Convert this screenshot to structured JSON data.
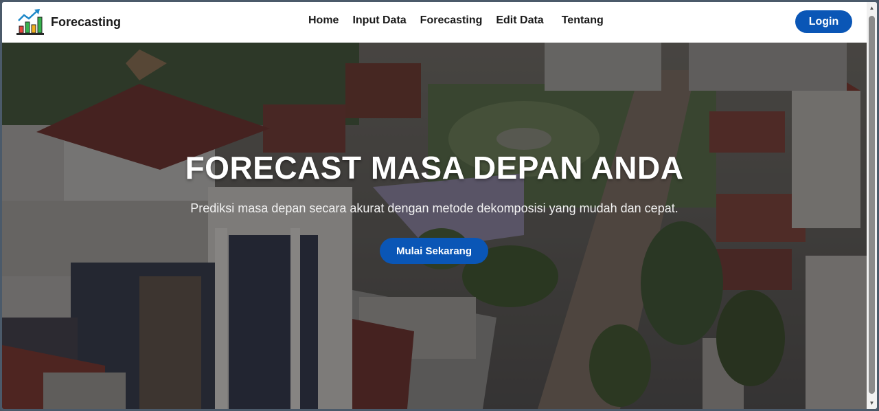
{
  "navbar": {
    "brand": "Forecasting",
    "links": [
      "Home",
      "Input Data",
      "Forecasting",
      "Edit Data",
      "Tentang"
    ],
    "login_label": "Login"
  },
  "hero": {
    "title": "FORECAST MASA DEPAN ANDA",
    "subtitle": "Prediksi masa depan secara akurat dengan metode dekomposisi yang mudah dan cepat.",
    "cta_label": "Mulai Sekarang"
  },
  "colors": {
    "accent": "#0a56b6",
    "nav_text": "#1a1a1a",
    "overlay": "#19191e"
  },
  "icons": {
    "brand": "bar-chart-growth-icon",
    "scroll_up": "triangle-up-icon",
    "scroll_down": "triangle-down-icon"
  }
}
